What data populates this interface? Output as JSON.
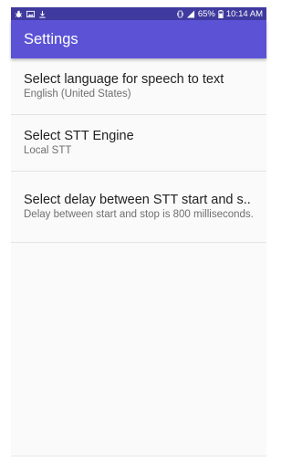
{
  "status_bar": {
    "battery_percent": "65%",
    "time": "10:14 AM",
    "left_icons": [
      "bug-icon",
      "image-icon",
      "download-icon"
    ],
    "right_icons": [
      "vibrate-icon",
      "signal-icon",
      "battery-icon"
    ]
  },
  "app_bar": {
    "title": "Settings"
  },
  "preferences": [
    {
      "title": "Select language for speech to text",
      "summary": "English (United States)"
    },
    {
      "title": "Select STT Engine",
      "summary": "Local STT"
    },
    {
      "title": "Select delay between STT start and s..",
      "summary": "Delay between start and stop is 800 milliseconds."
    }
  ],
  "colors": {
    "status_bar": "#3f3a9e",
    "app_bar": "#5b52d6",
    "background": "#fafafa",
    "divider": "#e4e4e4"
  }
}
